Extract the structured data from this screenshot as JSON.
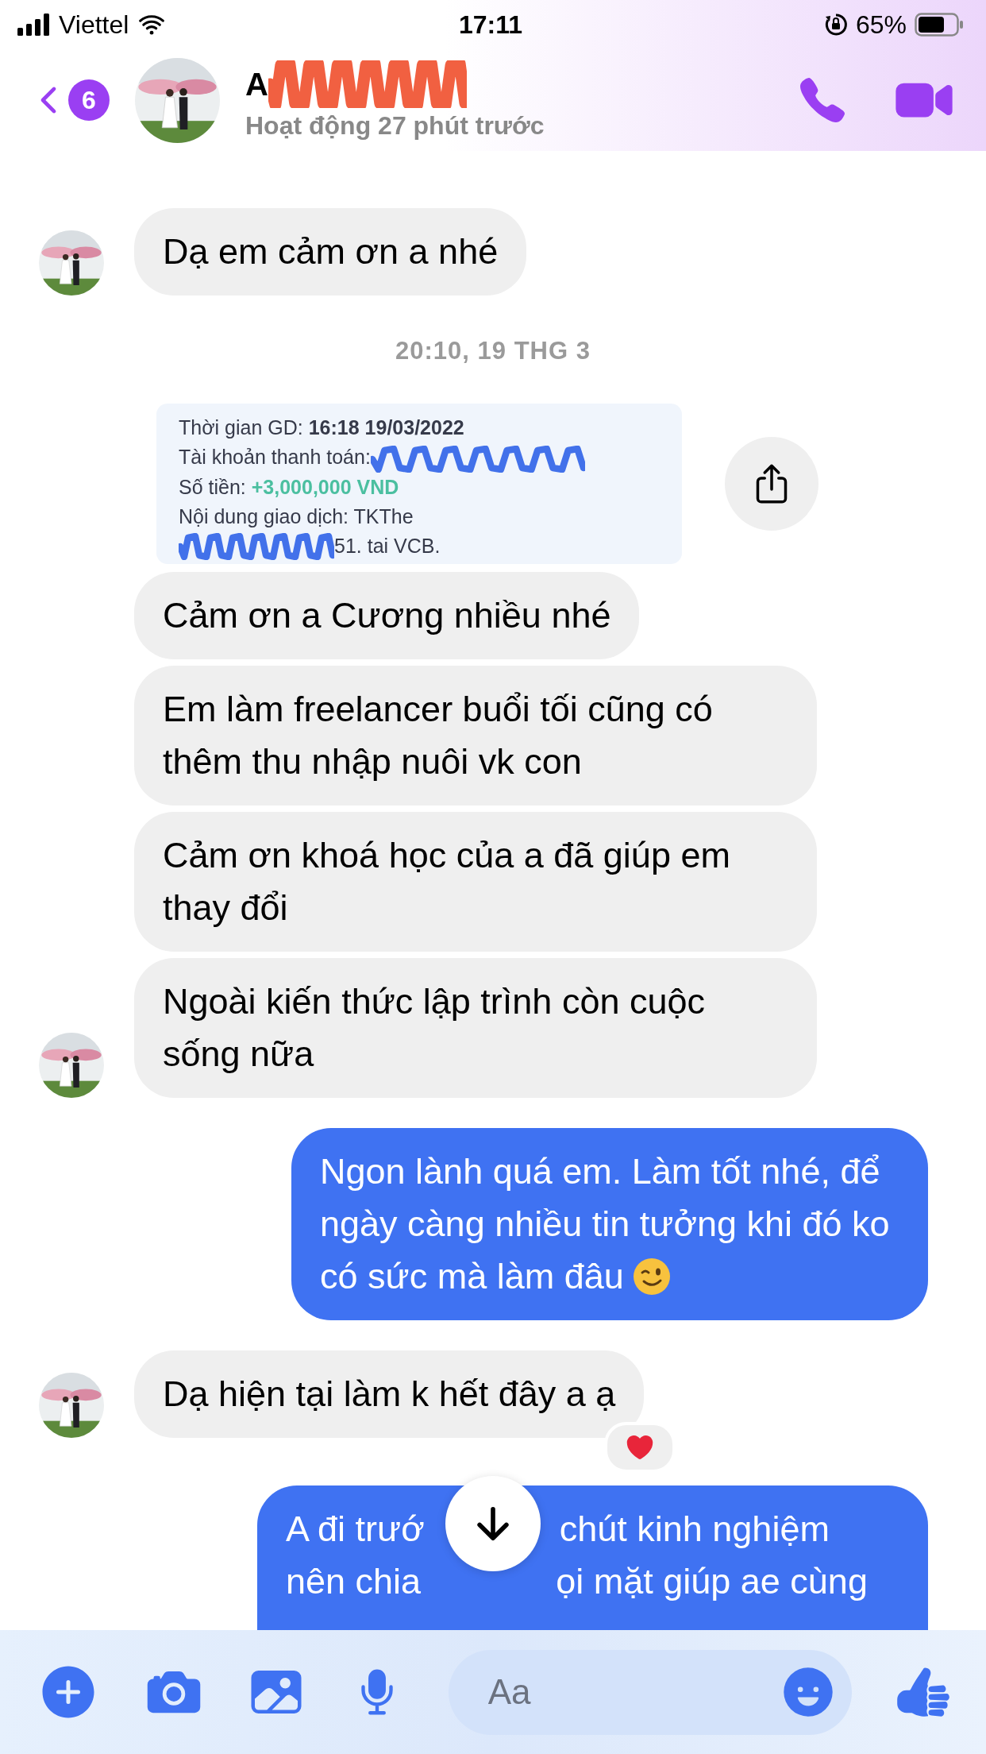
{
  "status_bar": {
    "carrier": "Viettel",
    "time": "17:11",
    "battery": "65%"
  },
  "header": {
    "back_badge": "6",
    "name": "A",
    "activity": "Hoạt động 27 phút trước"
  },
  "messages": [
    {
      "kind": "received",
      "text": "Dạ em cảm ơn a nhé",
      "avatar": true,
      "reacted": false
    },
    {
      "kind": "timestamp",
      "text": "20:10, 19 THG 3"
    },
    {
      "kind": "receipt",
      "time_label": "Thời gian GD:",
      "time_value": "16:18 19/03/2022",
      "account_label": "Tài khoản thanh toán:",
      "amount_label": "Số tiền:",
      "amount_value": "+3,000,000 VND",
      "content_label": "Nội dung giao dịch: TKThe",
      "content_tail": "51. tai VCB."
    },
    {
      "kind": "received",
      "text": "Cảm ơn a Cương nhiều nhé",
      "avatar": false,
      "reacted": false
    },
    {
      "kind": "received",
      "text": "Em làm freelancer buổi tối cũng có thêm thu nhập nuôi vk con",
      "avatar": false,
      "reacted": false
    },
    {
      "kind": "received",
      "text": "Cảm ơn khoá học của a đã giúp em thay đổi",
      "avatar": false,
      "reacted": false
    },
    {
      "kind": "received",
      "text": "Ngoài kiến thức lập trình còn cuộc sống nữa",
      "avatar": true,
      "reacted": false
    },
    {
      "kind": "sent",
      "text": "Ngon lành quá em. Làm tốt nhé, để ngày càng nhiều tin tưởng khi đó ko có sức mà làm đâu",
      "has_emoji": true
    },
    {
      "kind": "received",
      "text": "Dạ hiện tại làm k hết đây a ạ",
      "avatar": true,
      "reacted": true
    },
    {
      "kind": "sent_partial",
      "lines": [
        [
          "A đi trướ",
          "chút kinh nghiệm"
        ],
        [
          "nên chia",
          "ọi mặt giúp ae cùng"
        ]
      ]
    }
  ],
  "composer": {
    "placeholder": "Aa"
  }
}
